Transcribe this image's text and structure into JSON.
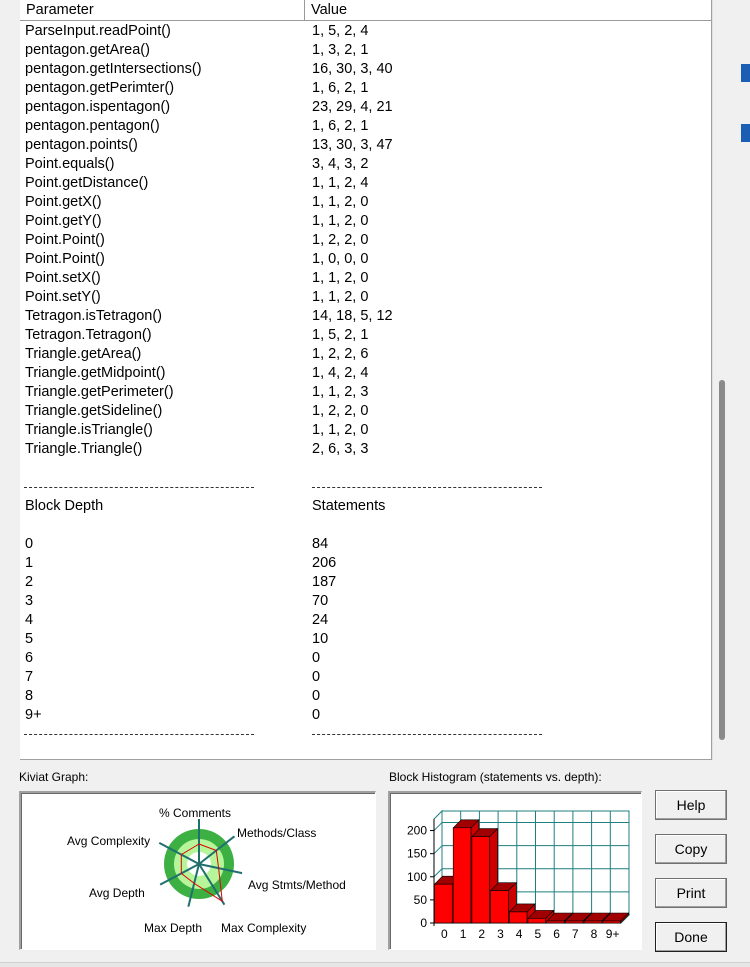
{
  "table": {
    "header_param": "Parameter",
    "header_value": "Value",
    "method_rows": [
      {
        "name": "ParseInput.readPoint()",
        "value": "1, 5, 2, 4"
      },
      {
        "name": "pentagon.getArea()",
        "value": "1, 3, 2, 1"
      },
      {
        "name": "pentagon.getIntersections()",
        "value": "16, 30, 3, 40"
      },
      {
        "name": "pentagon.getPerimter()",
        "value": "1, 6, 2, 1"
      },
      {
        "name": "pentagon.ispentagon()",
        "value": "23, 29, 4, 21"
      },
      {
        "name": "pentagon.pentagon()",
        "value": "1, 6, 2, 1"
      },
      {
        "name": "pentagon.points()",
        "value": "13, 30, 3, 47"
      },
      {
        "name": "Point.equals()",
        "value": "3, 4, 3, 2"
      },
      {
        "name": "Point.getDistance()",
        "value": "1, 1, 2, 4"
      },
      {
        "name": "Point.getX()",
        "value": "1, 1, 2, 0"
      },
      {
        "name": "Point.getY()",
        "value": "1, 1, 2, 0"
      },
      {
        "name": "Point.Point()",
        "value": "1, 2, 2, 0"
      },
      {
        "name": "Point.Point()",
        "value": "1, 0, 0, 0"
      },
      {
        "name": "Point.setX()",
        "value": "1, 1, 2, 0"
      },
      {
        "name": "Point.setY()",
        "value": "1, 1, 2, 0"
      },
      {
        "name": "Tetragon.isTetragon()",
        "value": "14, 18, 5, 12"
      },
      {
        "name": "Tetragon.Tetragon()",
        "value": "1, 5, 2, 1"
      },
      {
        "name": "Triangle.getArea()",
        "value": "1, 2, 2, 6"
      },
      {
        "name": "Triangle.getMidpoint()",
        "value": "1, 4, 2, 4"
      },
      {
        "name": "Triangle.getPerimeter()",
        "value": "1, 1, 2, 3"
      },
      {
        "name": "Triangle.getSideline()",
        "value": "1, 2, 2, 0"
      },
      {
        "name": "Triangle.isTriangle()",
        "value": "1, 1, 2, 0"
      },
      {
        "name": "Triangle.Triangle()",
        "value": "2, 6, 3, 3"
      }
    ],
    "separator": "---------------------------------------------",
    "block_header_param": "Block Depth",
    "block_header_value": "Statements",
    "block_rows": [
      {
        "depth": "0",
        "statements": "84"
      },
      {
        "depth": "1",
        "statements": "206"
      },
      {
        "depth": "2",
        "statements": "187"
      },
      {
        "depth": "3",
        "statements": "70"
      },
      {
        "depth": "4",
        "statements": "24"
      },
      {
        "depth": "5",
        "statements": "10"
      },
      {
        "depth": "6",
        "statements": "0"
      },
      {
        "depth": "7",
        "statements": "0"
      },
      {
        "depth": "8",
        "statements": "0"
      },
      {
        "depth": "9+",
        "statements": "0"
      }
    ]
  },
  "kiviat": {
    "label": "Kiviat Graph:",
    "axes": [
      "% Comments",
      "Methods/Class",
      "Avg Stmts/Method",
      "Max Complexity",
      "Max Depth",
      "Avg Depth",
      "Avg Complexity"
    ],
    "colors": {
      "outer_ring": "#3cb043",
      "band": "#b6f59a",
      "axis": "#1f6f6f",
      "polygon": "#e00000"
    }
  },
  "histogram": {
    "label": "Block Histogram (statements vs. depth):",
    "bar_color": "#ff0000",
    "grid_color": "#1f7f7f"
  },
  "chart_data": {
    "type": "bar",
    "categories": [
      "0",
      "1",
      "2",
      "3",
      "4",
      "5",
      "6",
      "7",
      "8",
      "9+"
    ],
    "values": [
      84,
      206,
      187,
      70,
      24,
      10,
      0,
      0,
      0,
      0
    ],
    "yticks": [
      "0",
      "50",
      "100",
      "150",
      "200"
    ],
    "ylim": [
      0,
      225
    ]
  },
  "buttons": {
    "help": "Help",
    "copy": "Copy",
    "print": "Print",
    "done": "Done"
  }
}
